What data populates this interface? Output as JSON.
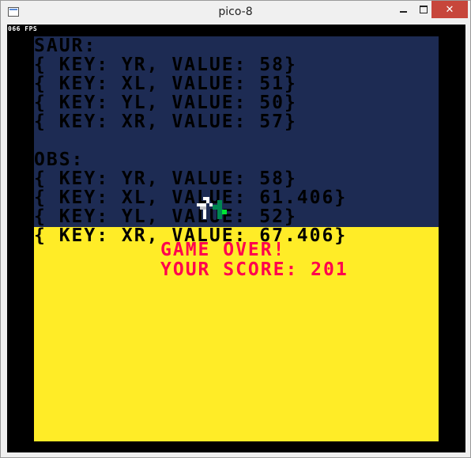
{
  "window": {
    "title": "pico-8"
  },
  "hud": {
    "fps": "066 FPS"
  },
  "colors": {
    "sky": "#1d2b53",
    "ground": "#ffec27",
    "debug_text": "#000000",
    "game_over_text": "#ff004d",
    "fps_text": "#ffffff"
  },
  "debug": {
    "saur_header": "SAUR:",
    "saur": [
      "{ KEY: YR, VALUE: 58}",
      "{ KEY: XL, VALUE: 51}",
      "{ KEY: YL, VALUE: 50}",
      "{ KEY: XR, VALUE: 57}"
    ],
    "obs_header": "OBS:",
    "obs": [
      "{ KEY: YR, VALUE: 58}",
      "{ KEY: XL, VALUE: 61.406}",
      "{ KEY: YL, VALUE: 52}",
      "{ KEY: XR, VALUE: 67.406}"
    ]
  },
  "game_over": {
    "title": "GAME OVER!",
    "score": "YOUR SCORE: 201"
  }
}
